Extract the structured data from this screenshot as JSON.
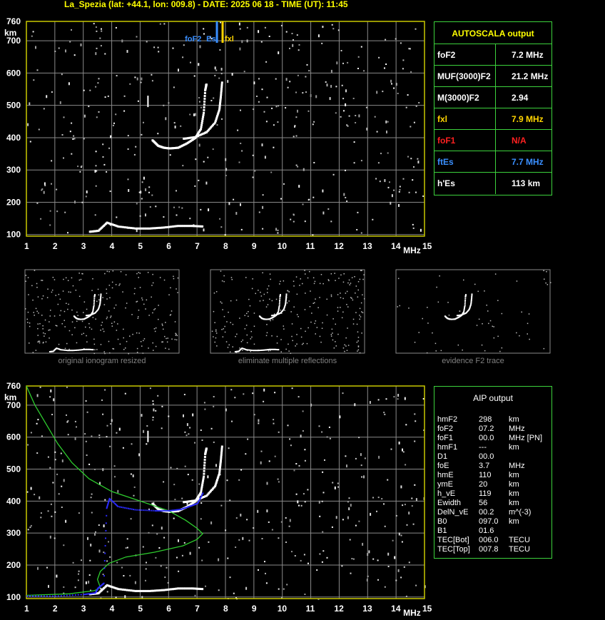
{
  "header": {
    "title": "La_Spezia (lat: +44.1, lon: 009.8) - DATE: 2025 06 18 - TIME (UT): 11:45"
  },
  "colors": {
    "grid": "#8a8a8a",
    "frame": "#c8c800",
    "trace": "#ffffff",
    "profile": "#2ecc2e",
    "aip_trace": "#2b2bff",
    "es": "#3a8fff",
    "fxl": "#ffd400",
    "green_border": "#3cd23c",
    "na": "#ff2020"
  },
  "chart_data": [
    {
      "type": "scatter",
      "title": "",
      "xlabel": "MHz",
      "ylabel": "km",
      "xlim": [
        1,
        15
      ],
      "ylim": [
        95,
        760
      ],
      "x_ticks": [
        "1",
        "2",
        "3",
        "4",
        "5",
        "6",
        "7",
        "8",
        "9",
        "10",
        "11",
        "12",
        "13",
        "14",
        "15"
      ],
      "y_ticks": [
        "100",
        "200",
        "300",
        "400",
        "500",
        "600",
        "700",
        "760"
      ],
      "markers": [
        {
          "label": "foF2",
          "x": 7.2
        },
        {
          "label": "Es",
          "x": 7.7
        },
        {
          "label": "fxl",
          "x": 7.9
        }
      ],
      "series": [
        {
          "values": [
            [
              3.2,
              112
            ],
            [
              3.5,
              115
            ],
            [
              3.8,
              140
            ],
            [
              4.2,
              128
            ],
            [
              4.8,
              122
            ],
            [
              5.3,
              122
            ],
            [
              5.8,
              125
            ],
            [
              6.3,
              130
            ],
            [
              6.8,
              130
            ],
            [
              7.2,
              128
            ]
          ]
        },
        {
          "values": [
            [
              5.4,
              395
            ],
            [
              5.6,
              378
            ],
            [
              5.8,
              372
            ],
            [
              6.0,
              370
            ],
            [
              6.3,
              372
            ],
            [
              6.6,
              385
            ],
            [
              6.9,
              402
            ],
            [
              7.1,
              430
            ],
            [
              7.2,
              480
            ],
            [
              7.25,
              550
            ],
            [
              7.3,
              570
            ]
          ]
        },
        {
          "values": [
            [
              6.5,
              400
            ],
            [
              6.9,
              405
            ],
            [
              7.3,
              420
            ],
            [
              7.6,
              450
            ],
            [
              7.75,
              490
            ],
            [
              7.8,
              530
            ],
            [
              7.85,
              580
            ]
          ]
        }
      ]
    },
    {
      "type": "line",
      "title": "",
      "xlabel": "MHz",
      "ylabel": "km",
      "xlim": [
        1,
        15
      ],
      "ylim": [
        95,
        760
      ],
      "x_ticks": [
        "1",
        "2",
        "3",
        "4",
        "5",
        "6",
        "7",
        "8",
        "9",
        "10",
        "11",
        "12",
        "13",
        "14",
        "15"
      ],
      "y_ticks": [
        "100",
        "200",
        "300",
        "400",
        "500",
        "600",
        "700",
        "760"
      ],
      "series": [
        {
          "values": [
            [
              1.0,
              760
            ],
            [
              1.3,
              700
            ],
            [
              1.7,
              640
            ],
            [
              2.1,
              580
            ],
            [
              2.6,
              520
            ],
            [
              3.2,
              470
            ],
            [
              4.0,
              430
            ],
            [
              5.0,
              400
            ],
            [
              6.0,
              370
            ],
            [
              6.6,
              340
            ],
            [
              7.0,
              315
            ],
            [
              7.2,
              298
            ],
            [
              7.0,
              280
            ],
            [
              6.5,
              260
            ],
            [
              5.5,
              240
            ],
            [
              4.5,
              225
            ],
            [
              3.9,
              205
            ],
            [
              3.6,
              180
            ],
            [
              3.5,
              155
            ],
            [
              3.6,
              130
            ],
            [
              3.4,
              120
            ],
            [
              2.5,
              110
            ],
            [
              1.0,
              105
            ]
          ]
        },
        {
          "values": [
            [
              1.0,
              105
            ],
            [
              2.0,
              105
            ],
            [
              3.0,
              110
            ],
            [
              3.4,
              115
            ],
            [
              3.5,
              130
            ],
            [
              3.7,
              145
            ],
            [
              3.8,
              380
            ],
            [
              3.9,
              410
            ],
            [
              4.2,
              385
            ],
            [
              4.8,
              375
            ],
            [
              5.5,
              372
            ],
            [
              6.0,
              372
            ],
            [
              6.4,
              376
            ],
            [
              6.7,
              385
            ],
            [
              7.0,
              395
            ],
            [
              7.2,
              430
            ]
          ]
        }
      ]
    }
  ],
  "previews": {
    "captions": [
      "original ionogram resized",
      "eliminate multiple reflections",
      "evidence F2 trace"
    ]
  },
  "autoscala": {
    "title": "AUTOSCALA output",
    "rows": [
      {
        "key": "foF2",
        "value": "7.2 MHz",
        "color": "#ffffff"
      },
      {
        "key": "MUF(3000)F2",
        "value": "21.2 MHz",
        "color": "#ffffff"
      },
      {
        "key": "M(3000)F2",
        "value": "2.94",
        "color": "#ffffff"
      },
      {
        "key": "fxl",
        "value": "7.9 MHz",
        "color": "#ffd400"
      },
      {
        "key": "foF1",
        "value": "N/A",
        "color": "#ff2020"
      },
      {
        "key": "ftEs",
        "value": "7.7 MHz",
        "color": "#3a8fff"
      },
      {
        "key": "h'Es",
        "value": "113     km",
        "color": "#ffffff"
      }
    ]
  },
  "aip": {
    "title": "AIP output",
    "rows": [
      [
        "hmF2",
        "298",
        "km"
      ],
      [
        "foF2",
        "07.2",
        "MHz"
      ],
      [
        "foF1",
        "00.0",
        "MHz   [PN]"
      ],
      [
        "hmF1",
        "---",
        "km"
      ],
      [
        "D1",
        "00.0",
        ""
      ],
      [
        "foE",
        "3.7",
        "MHz"
      ],
      [
        "hmE",
        "110",
        "km"
      ],
      [
        "ymE",
        "20",
        "km"
      ],
      [
        "h_vE",
        "119",
        "km"
      ],
      [
        "Ewidth",
        "56",
        "km"
      ],
      [
        "DelN_vE",
        "00.2",
        "m^(-3)"
      ],
      [
        "B0",
        "097.0",
        "km"
      ],
      [
        "B1",
        "01.6",
        ""
      ],
      [
        "TEC[Bot]",
        "006.0",
        "TECU"
      ],
      [
        "TEC[Top]",
        "007.8",
        "TECU"
      ]
    ]
  }
}
